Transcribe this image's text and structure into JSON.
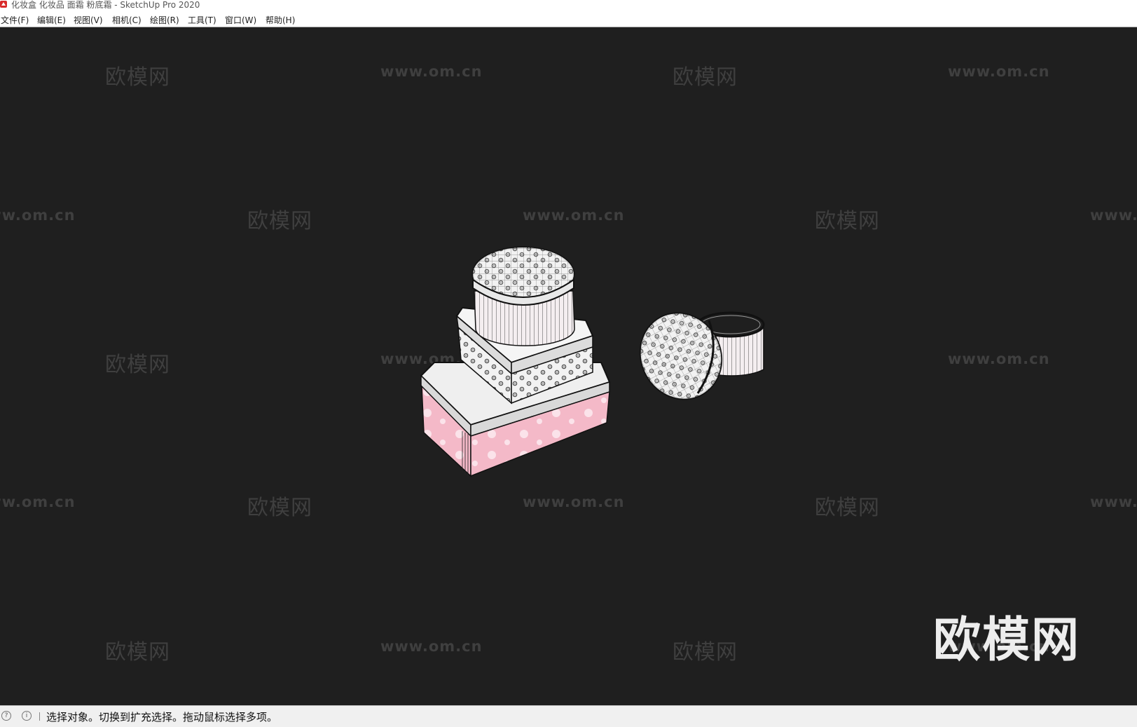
{
  "window": {
    "title": "化妆盒 化妆品 面霜 粉底霜 - SketchUp Pro 2020",
    "logo_icon": "sketchup-logo-icon",
    "accent_color": "#d92b2b"
  },
  "menu": [
    {
      "label": "文件(F)"
    },
    {
      "label": "编辑(E)"
    },
    {
      "label": "视图(V)"
    },
    {
      "label": "相机(C)"
    },
    {
      "label": "绘图(R)"
    },
    {
      "label": "工具(T)"
    },
    {
      "label": "窗口(W)"
    },
    {
      "label": "帮助(H)"
    }
  ],
  "watermark": {
    "brand": "欧模网",
    "url": "www.om.cn",
    "url_partial": "www."
  },
  "model": {
    "pink_color": "#f4b9c8",
    "white_color": "#f4f4f4",
    "pattern_color": "#555555"
  },
  "status": {
    "text": "选择对象。切换到扩充选择。拖动鼠标选择多项。",
    "icons": [
      "geolocation-icon",
      "info-icon"
    ]
  }
}
